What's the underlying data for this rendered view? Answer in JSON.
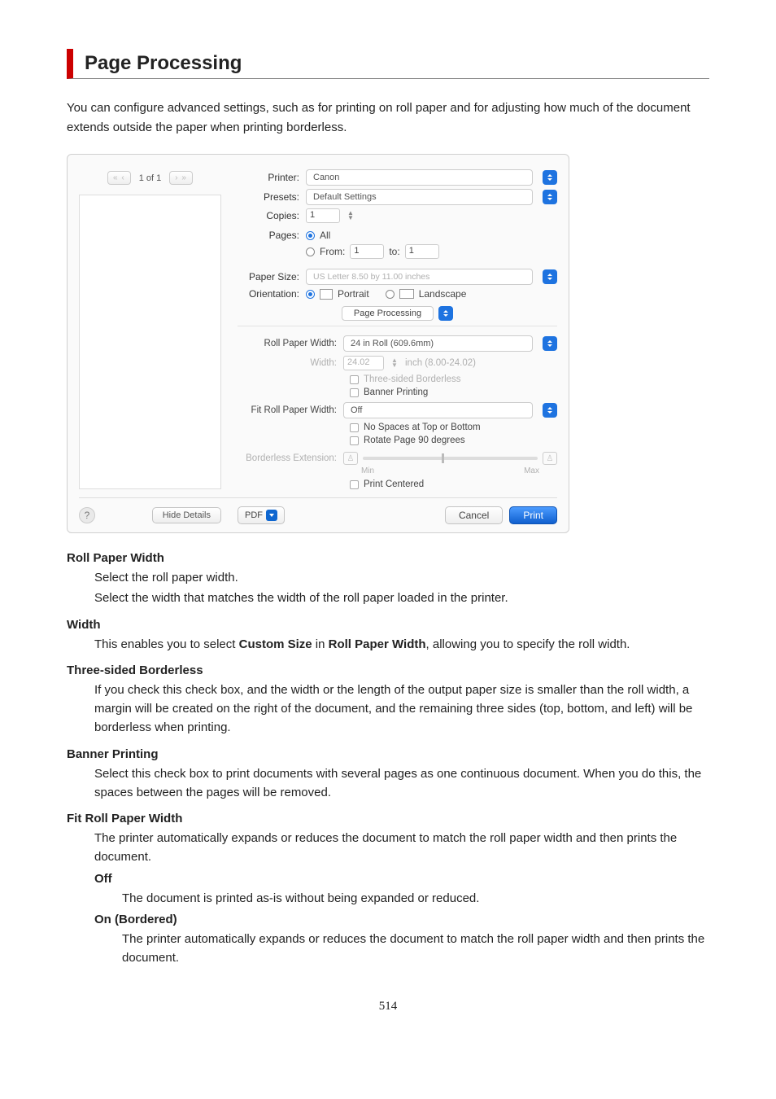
{
  "header": {
    "title": "Page Processing"
  },
  "intro": "You can configure advanced settings, such as for printing on roll paper and for adjusting how much of the document extends outside the paper when printing borderless.",
  "dialog": {
    "nav": {
      "first": "«",
      "prev": "‹",
      "indicator": "1 of 1",
      "next": "›",
      "last": "»"
    },
    "printer_label": "Printer:",
    "printer_value": "Canon",
    "presets_label": "Presets:",
    "presets_value": "Default Settings",
    "copies_label": "Copies:",
    "copies_value": "1",
    "pages_label": "Pages:",
    "pages_all": "All",
    "pages_from_label": "From:",
    "pages_from": "1",
    "pages_to_label": "to:",
    "pages_to": "1",
    "paper_size_label": "Paper Size:",
    "paper_size_value": "US Letter 8.50 by 11.00 inches",
    "orientation_label": "Orientation:",
    "orient_portrait": "Portrait",
    "orient_landscape": "Landscape",
    "section_select": "Page Processing",
    "rpw_label": "Roll Paper Width:",
    "rpw_value": "24 in Roll (609.6mm)",
    "w_label": "Width:",
    "w_value": "24.02",
    "w_unit": "inch (8.00-24.02)",
    "three_sided": "Three-sided Borderless",
    "banner": "Banner Printing",
    "fit_label": "Fit Roll Paper Width:",
    "fit_value": "Off",
    "no_spaces": "No Spaces at Top or Bottom",
    "rotate90": "Rotate Page 90 degrees",
    "bext_label": "Borderless Extension:",
    "min": "Min",
    "max": "Max",
    "print_centered": "Print Centered",
    "hide_details": "Hide Details",
    "pdf": "PDF",
    "cancel": "Cancel",
    "print": "Print"
  },
  "defs": {
    "rpw_t": "Roll Paper Width",
    "rpw_d1": "Select the roll paper width.",
    "rpw_d2": "Select the width that matches the width of the roll paper loaded in the printer.",
    "w_t": "Width",
    "w_d_pre": "This enables you to select ",
    "w_d_b1": "Custom Size",
    "w_d_mid": " in ",
    "w_d_b2": "Roll Paper Width",
    "w_d_post": ", allowing you to specify the roll width.",
    "ts_t": "Three-sided Borderless",
    "ts_d": "If you check this check box, and the width or the length of the output paper size is smaller than the roll width, a margin will be created on the right of the document, and the remaining three sides (top, bottom, and left) will be borderless when printing.",
    "bp_t": "Banner Printing",
    "bp_d": "Select this check box to print documents with several pages as one continuous document. When you do this, the spaces between the pages will be removed.",
    "frpw_t": "Fit Roll Paper Width",
    "frpw_d": "The printer automatically expands or reduces the document to match the roll paper width and then prints the document.",
    "off_t": "Off",
    "off_d": "The document is printed as-is without being expanded or reduced.",
    "onb_t": "On (Bordered)",
    "onb_d": "The printer automatically expands or reduces the document to match the roll paper width and then prints the document."
  },
  "page_number": "514"
}
